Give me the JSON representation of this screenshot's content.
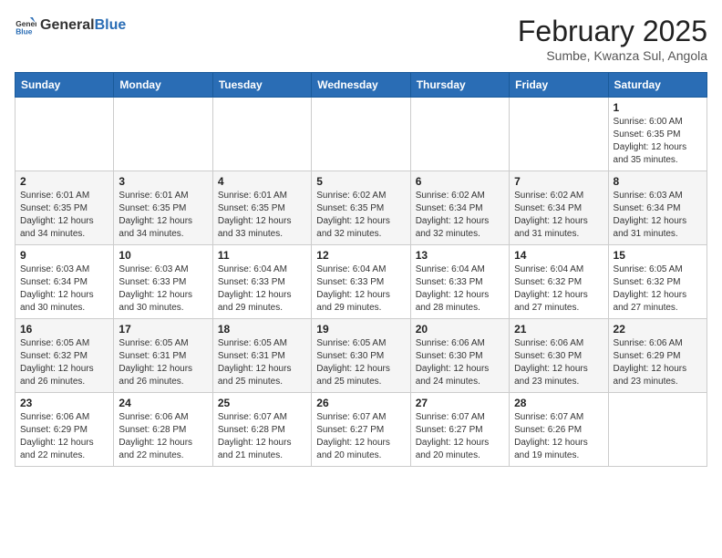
{
  "header": {
    "logo_general": "General",
    "logo_blue": "Blue",
    "month": "February 2025",
    "location": "Sumbe, Kwanza Sul, Angola"
  },
  "days_of_week": [
    "Sunday",
    "Monday",
    "Tuesday",
    "Wednesday",
    "Thursday",
    "Friday",
    "Saturday"
  ],
  "weeks": [
    [
      {
        "day": "",
        "info": ""
      },
      {
        "day": "",
        "info": ""
      },
      {
        "day": "",
        "info": ""
      },
      {
        "day": "",
        "info": ""
      },
      {
        "day": "",
        "info": ""
      },
      {
        "day": "",
        "info": ""
      },
      {
        "day": "1",
        "info": "Sunrise: 6:00 AM\nSunset: 6:35 PM\nDaylight: 12 hours\nand 35 minutes."
      }
    ],
    [
      {
        "day": "2",
        "info": "Sunrise: 6:01 AM\nSunset: 6:35 PM\nDaylight: 12 hours\nand 34 minutes."
      },
      {
        "day": "3",
        "info": "Sunrise: 6:01 AM\nSunset: 6:35 PM\nDaylight: 12 hours\nand 34 minutes."
      },
      {
        "day": "4",
        "info": "Sunrise: 6:01 AM\nSunset: 6:35 PM\nDaylight: 12 hours\nand 33 minutes."
      },
      {
        "day": "5",
        "info": "Sunrise: 6:02 AM\nSunset: 6:35 PM\nDaylight: 12 hours\nand 32 minutes."
      },
      {
        "day": "6",
        "info": "Sunrise: 6:02 AM\nSunset: 6:34 PM\nDaylight: 12 hours\nand 32 minutes."
      },
      {
        "day": "7",
        "info": "Sunrise: 6:02 AM\nSunset: 6:34 PM\nDaylight: 12 hours\nand 31 minutes."
      },
      {
        "day": "8",
        "info": "Sunrise: 6:03 AM\nSunset: 6:34 PM\nDaylight: 12 hours\nand 31 minutes."
      }
    ],
    [
      {
        "day": "9",
        "info": "Sunrise: 6:03 AM\nSunset: 6:34 PM\nDaylight: 12 hours\nand 30 minutes."
      },
      {
        "day": "10",
        "info": "Sunrise: 6:03 AM\nSunset: 6:33 PM\nDaylight: 12 hours\nand 30 minutes."
      },
      {
        "day": "11",
        "info": "Sunrise: 6:04 AM\nSunset: 6:33 PM\nDaylight: 12 hours\nand 29 minutes."
      },
      {
        "day": "12",
        "info": "Sunrise: 6:04 AM\nSunset: 6:33 PM\nDaylight: 12 hours\nand 29 minutes."
      },
      {
        "day": "13",
        "info": "Sunrise: 6:04 AM\nSunset: 6:33 PM\nDaylight: 12 hours\nand 28 minutes."
      },
      {
        "day": "14",
        "info": "Sunrise: 6:04 AM\nSunset: 6:32 PM\nDaylight: 12 hours\nand 27 minutes."
      },
      {
        "day": "15",
        "info": "Sunrise: 6:05 AM\nSunset: 6:32 PM\nDaylight: 12 hours\nand 27 minutes."
      }
    ],
    [
      {
        "day": "16",
        "info": "Sunrise: 6:05 AM\nSunset: 6:32 PM\nDaylight: 12 hours\nand 26 minutes."
      },
      {
        "day": "17",
        "info": "Sunrise: 6:05 AM\nSunset: 6:31 PM\nDaylight: 12 hours\nand 26 minutes."
      },
      {
        "day": "18",
        "info": "Sunrise: 6:05 AM\nSunset: 6:31 PM\nDaylight: 12 hours\nand 25 minutes."
      },
      {
        "day": "19",
        "info": "Sunrise: 6:05 AM\nSunset: 6:30 PM\nDaylight: 12 hours\nand 25 minutes."
      },
      {
        "day": "20",
        "info": "Sunrise: 6:06 AM\nSunset: 6:30 PM\nDaylight: 12 hours\nand 24 minutes."
      },
      {
        "day": "21",
        "info": "Sunrise: 6:06 AM\nSunset: 6:30 PM\nDaylight: 12 hours\nand 23 minutes."
      },
      {
        "day": "22",
        "info": "Sunrise: 6:06 AM\nSunset: 6:29 PM\nDaylight: 12 hours\nand 23 minutes."
      }
    ],
    [
      {
        "day": "23",
        "info": "Sunrise: 6:06 AM\nSunset: 6:29 PM\nDaylight: 12 hours\nand 22 minutes."
      },
      {
        "day": "24",
        "info": "Sunrise: 6:06 AM\nSunset: 6:28 PM\nDaylight: 12 hours\nand 22 minutes."
      },
      {
        "day": "25",
        "info": "Sunrise: 6:07 AM\nSunset: 6:28 PM\nDaylight: 12 hours\nand 21 minutes."
      },
      {
        "day": "26",
        "info": "Sunrise: 6:07 AM\nSunset: 6:27 PM\nDaylight: 12 hours\nand 20 minutes."
      },
      {
        "day": "27",
        "info": "Sunrise: 6:07 AM\nSunset: 6:27 PM\nDaylight: 12 hours\nand 20 minutes."
      },
      {
        "day": "28",
        "info": "Sunrise: 6:07 AM\nSunset: 6:26 PM\nDaylight: 12 hours\nand 19 minutes."
      },
      {
        "day": "",
        "info": ""
      }
    ]
  ]
}
